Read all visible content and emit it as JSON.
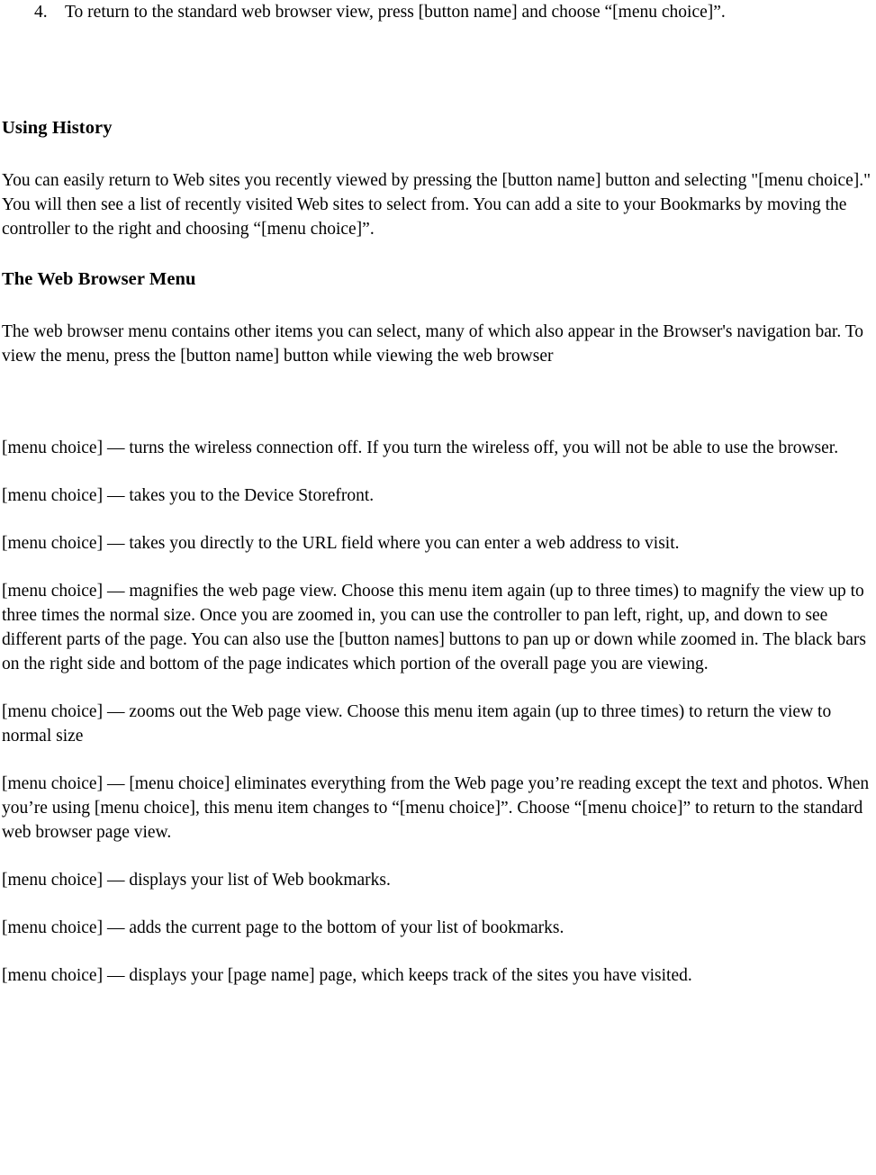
{
  "document": {
    "numbered_list": [
      {
        "marker": "4.",
        "text": "To return to the standard web browser view, press [button name] and choose “[menu choice]”."
      }
    ],
    "sections": [
      {
        "heading": "Using History",
        "paragraphs": [
          "You can easily return to Web sites you recently viewed by pressing the [button name] button and selecting \"[menu choice].\" You will then see a list of recently visited Web sites to select from. You can add a site to your Bookmarks by moving the controller to the right and choosing “[menu choice]”."
        ]
      },
      {
        "heading": "The Web Browser Menu",
        "paragraphs": [
          "The web browser menu contains other items you can select, many of which also appear in the Browser's navigation bar. To view the menu, press the [button name] button while viewing the web browser"
        ]
      }
    ],
    "menu_items": [
      "[menu choice] — turns the wireless connection off. If you turn the wireless off, you will not be able to use the browser.",
      "[menu choice] — takes you to the Device Storefront.",
      "[menu choice] — takes you directly to the URL field where you can enter a web address to visit.",
      "[menu choice] — magnifies the web page view. Choose this menu item again (up to three times) to magnify the view up to three times the normal size.  Once you are zoomed in, you can use the controller to pan left, right, up, and down to see different parts of the page. You can also use the [button names] buttons to pan up or down while zoomed in. The black bars on the right side and bottom of the page indicates which portion of the overall page you are viewing.",
      "[menu choice] — zooms out the Web page view. Choose this menu item again (up to three times) to return the view to normal size",
      "[menu choice] — [menu choice] eliminates everything from the Web page you’re reading except the text and photos. When you’re using [menu choice], this menu item changes to “[menu choice]”. Choose “[menu choice]” to return to the standard web browser page view.",
      "[menu choice] — displays your list of Web bookmarks.",
      "[menu choice] — adds the current page to the bottom of your list of bookmarks.",
      "[menu choice] — displays your [page name] page, which keeps track of the sites you have visited."
    ]
  }
}
